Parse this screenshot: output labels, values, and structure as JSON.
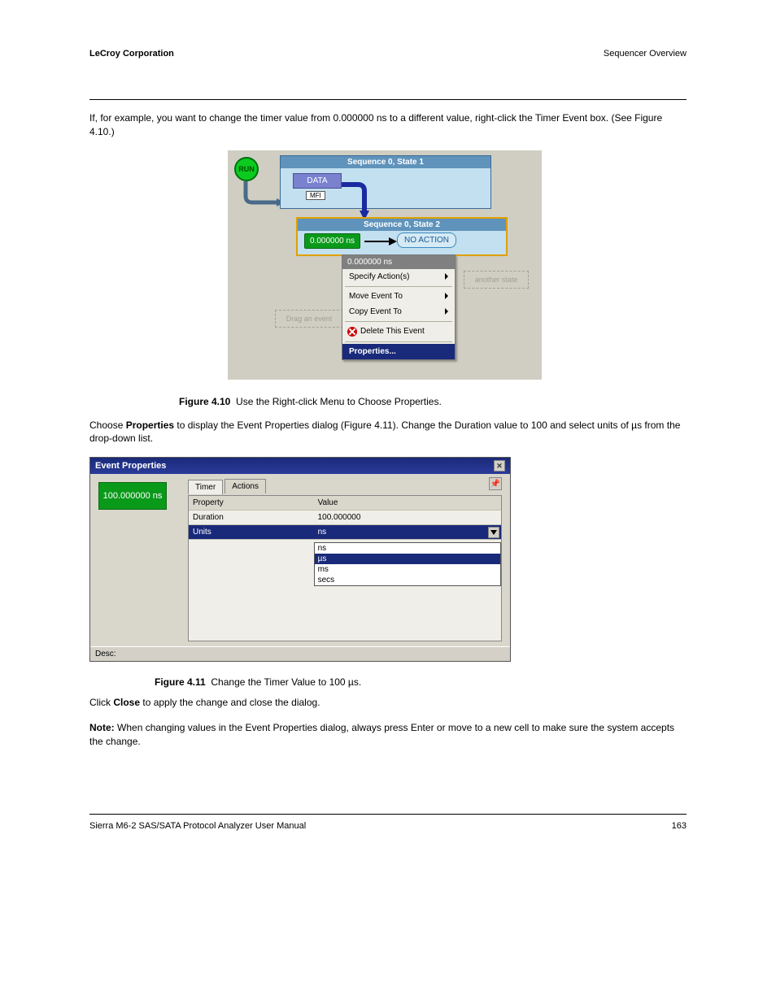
{
  "header": {
    "left": "LeCroy Corporation",
    "right": "Sequencer Overview"
  },
  "intro": "If, for example, you want to change the timer value from 0.000000 ns to a different value, right-click the Timer Event box. (See Figure 4.10.)",
  "fig1": {
    "label": "Figure 4.10",
    "caption": "Use the Right-click Menu to Choose Properties.",
    "run": "RUN",
    "state1": "Sequence 0, State 1",
    "state2": "Sequence 0, State 2",
    "data": "DATA",
    "mfi": "MFI",
    "time": "0.000000 ns",
    "noaction": "NO ACTION",
    "ghost_right": "another state",
    "ghost_left": "Drag an event",
    "menu_title": "0.000000 ns",
    "menu_items": {
      "specify": "Specify Action(s)",
      "move": "Move Event To",
      "copy": "Copy Event To",
      "delete": "Delete This Event",
      "properties": "Properties..."
    }
  },
  "between_text": "Choose Properties to display the Event Properties dialog (Figure 4.11). Change the Duration value to 100 and select units of µs from the drop-down list.",
  "fig2": {
    "label": "Figure 4.11",
    "caption": "Change the Timer Value to 100 µs.",
    "title": "Event Properties",
    "time_badge": "100.000000 ns",
    "tab_timer": "Timer",
    "tab_actions": "Actions",
    "col_property": "Property",
    "col_value": "Value",
    "row_duration_prop": "Duration",
    "row_duration_val": "100.000000",
    "row_units_prop": "Units",
    "row_units_val": "ns",
    "dropdown": [
      "ns",
      "µs",
      "ms",
      "secs"
    ],
    "dropdown_sel": "µs",
    "desc_label": "Desc:"
  },
  "after_text": "Click Close to apply the change and close the dialog.",
  "note_label": "Note:",
  "note_text": "When changing values in the Event Properties dialog, always press Enter or move to a new cell to make sure the system accepts the change.",
  "footer": {
    "left": "Sierra M6-2 SAS/SATA Protocol Analyzer User Manual",
    "right": "163"
  }
}
